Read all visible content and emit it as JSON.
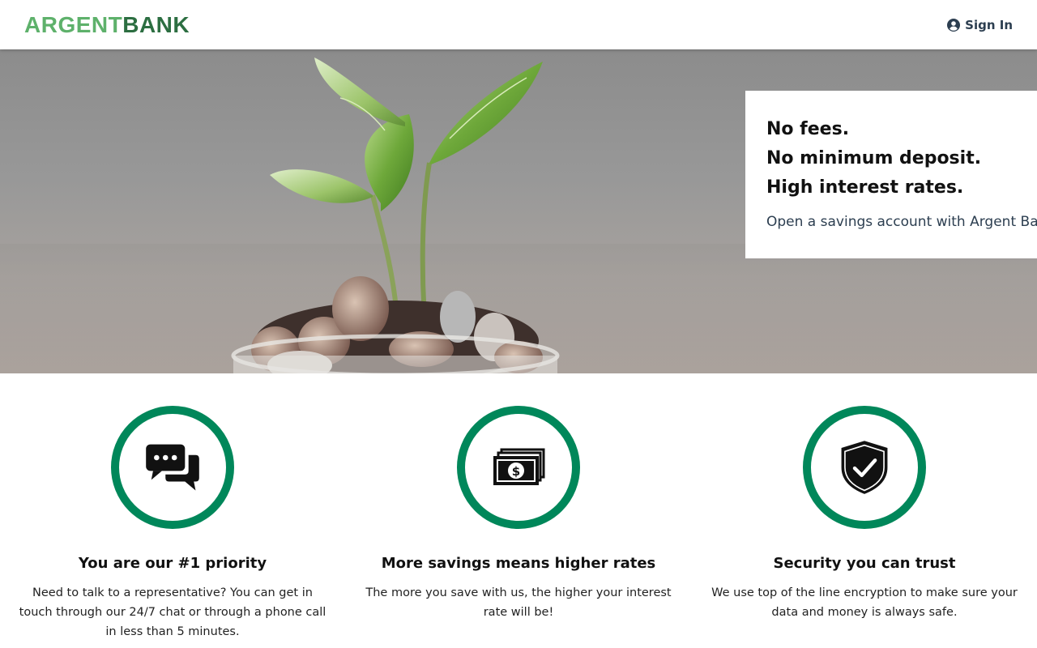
{
  "nav": {
    "logo_part1": "ARGENT",
    "logo_part2": "BANK",
    "signin_label": "Sign In",
    "signin_icon": "user-circle-icon"
  },
  "hero": {
    "line1": "No fees.",
    "line2": "No minimum deposit.",
    "line3": "High interest rates.",
    "subtitle": "Open a savings account with Argent Bank today!"
  },
  "features": [
    {
      "icon": "chat-icon",
      "title": "You are our #1 priority",
      "text": "Need to talk to a representative? You can get in touch through our 24/7 chat or through a phone call in less than 5 minutes."
    },
    {
      "icon": "money-icon",
      "title": "More savings means higher rates",
      "text": "The more you save with us, the higher your interest rate will be!"
    },
    {
      "icon": "security-icon",
      "title": "Security you can trust",
      "text": "We use top of the line encryption to make sure your data and money is always safe."
    }
  ],
  "colors": {
    "accent_green": "#00875a",
    "logo_light": "#5eb16b",
    "logo_dark": "#2c6e41"
  }
}
